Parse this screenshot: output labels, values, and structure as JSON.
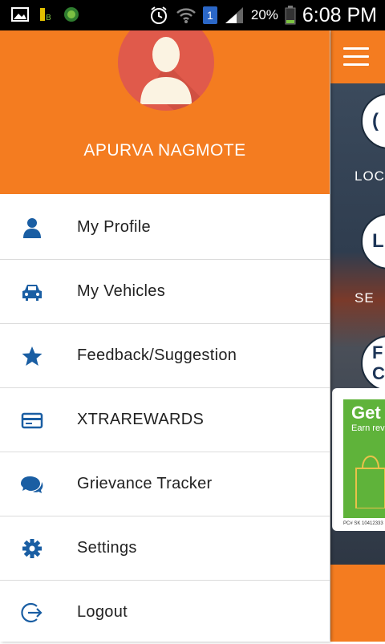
{
  "status_bar": {
    "time": "6:08 PM",
    "battery_percent": "20%",
    "sim_slot": "1"
  },
  "drawer": {
    "user_name": "APURVA NAGMOTE",
    "menu": [
      {
        "label": "My Profile",
        "icon": "person-icon"
      },
      {
        "label": "My Vehicles",
        "icon": "car-icon"
      },
      {
        "label": "Feedback/Suggestion",
        "icon": "star-icon"
      },
      {
        "label": "XTRAREWARDS",
        "icon": "card-icon"
      },
      {
        "label": "Grievance Tracker",
        "icon": "chat-bubble-icon"
      },
      {
        "label": "Settings",
        "icon": "gear-icon"
      },
      {
        "label": "Logout",
        "icon": "logout-icon"
      }
    ]
  },
  "background_app": {
    "circle_1_text": "(",
    "caption_1": "LOCA",
    "circle_2_text": "Lu",
    "caption_2": "SE",
    "circle_3_text": "F\nC",
    "promo_title": "Get",
    "promo_sub": "Earn rev",
    "promo_fine": "PC# SK 10412333"
  },
  "colors": {
    "accent": "#f47c20",
    "icon_blue": "#1a5ea3",
    "avatar_bg": "#e05a4b"
  }
}
